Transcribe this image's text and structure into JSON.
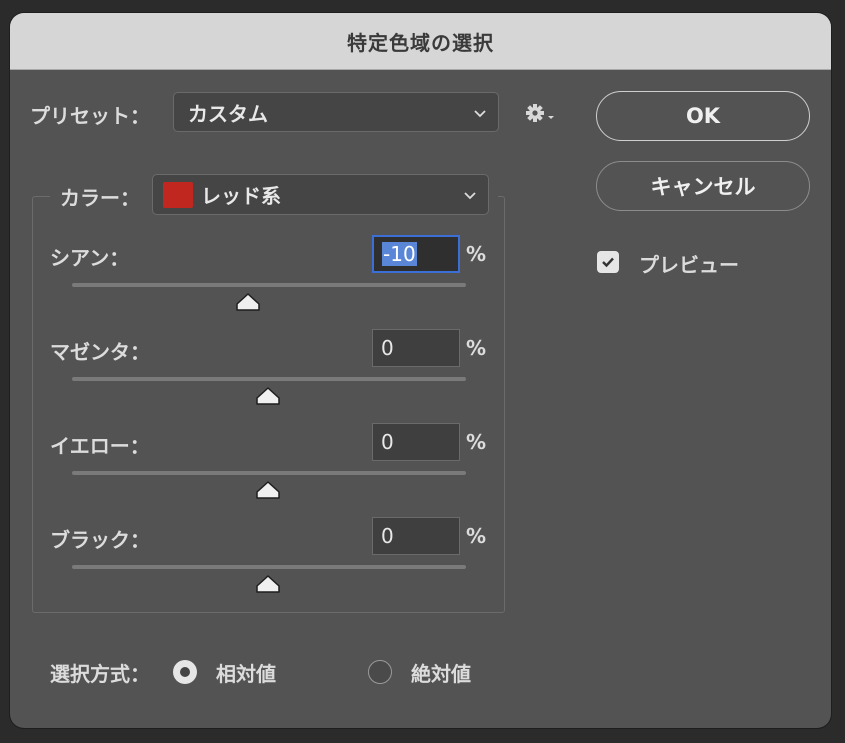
{
  "window": {
    "title": "特定色域の選択"
  },
  "preset": {
    "label": "プリセット：",
    "value": "カスタム"
  },
  "buttons": {
    "ok": "OK",
    "cancel": "キャンセル"
  },
  "preview": {
    "label": "プレビュー",
    "checked": true
  },
  "color": {
    "label": "カラー：",
    "value": "レッド系",
    "swatch": "#c0281f"
  },
  "sliders": [
    {
      "label": "シアン：",
      "value": "-10",
      "unit": "%"
    },
    {
      "label": "マゼンタ：",
      "value": "0",
      "unit": "%"
    },
    {
      "label": "イエロー：",
      "value": "0",
      "unit": "%"
    },
    {
      "label": "ブラック：",
      "value": "0",
      "unit": "%"
    }
  ],
  "method": {
    "label": "選択方式：",
    "relative": "相対値",
    "absolute": "絶対値",
    "selected": "相対値"
  }
}
